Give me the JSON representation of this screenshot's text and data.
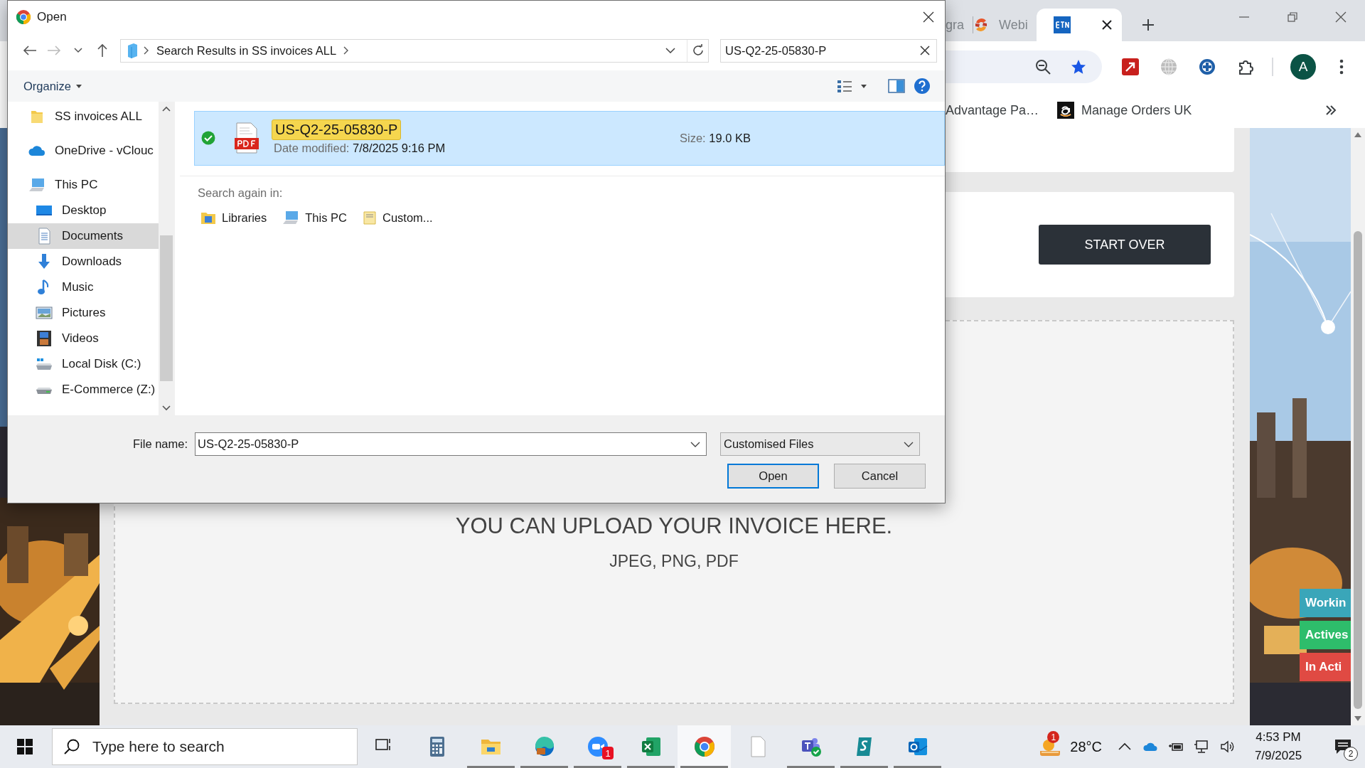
{
  "dialog": {
    "title": "Open",
    "path": "Search Results in SS invoices ALL",
    "search": "US-Q2-25-05830-P",
    "organize": "Organize",
    "nav_pane": [
      {
        "label": "SS invoices ALL",
        "kind": "folder",
        "selected": false
      },
      {
        "label": "OneDrive - vClouc",
        "kind": "onedrive",
        "selected": false
      },
      {
        "label": "This PC",
        "kind": "pc",
        "selected": false,
        "children": [
          {
            "label": "Desktop",
            "kind": "desktop",
            "selected": false
          },
          {
            "label": "Documents",
            "kind": "documents",
            "selected": true
          },
          {
            "label": "Downloads",
            "kind": "downloads",
            "selected": false
          },
          {
            "label": "Music",
            "kind": "music",
            "selected": false
          },
          {
            "label": "Pictures",
            "kind": "pictures",
            "selected": false
          },
          {
            "label": "Videos",
            "kind": "videos",
            "selected": false
          },
          {
            "label": "Local Disk (C:)",
            "kind": "disk",
            "selected": false
          },
          {
            "label": "E-Commerce (Z:)",
            "kind": "network-drive",
            "selected": false
          }
        ]
      }
    ],
    "results": [
      {
        "name": "US-Q2-25-05830-P",
        "date_label": "Date modified:",
        "date": "7/8/2025 9:16 PM",
        "size_label": "Size:",
        "size": "19.0 KB",
        "selected": true,
        "synced": true
      }
    ],
    "search_again": {
      "label": "Search again in:",
      "locations": [
        {
          "label": "Libraries",
          "kind": "libraries"
        },
        {
          "label": "This PC",
          "kind": "pc"
        },
        {
          "label": "Custom...",
          "kind": "custom"
        }
      ]
    },
    "file_name": {
      "label": "File name:",
      "value": "US-Q2-25-05830-P"
    },
    "file_type": "Customised Files",
    "buttons": [
      {
        "label": "Open",
        "default": true
      },
      {
        "label": "Cancel",
        "default": false
      }
    ]
  },
  "browser": {
    "tabs": [
      {
        "title": "gra",
        "selected": false
      },
      {
        "title": "Webi",
        "selected": false
      },
      {
        "selected": true
      }
    ],
    "bookmarks": [
      {
        "label": "Advantage Pa…"
      },
      {
        "label": "Manage Orders UK"
      }
    ],
    "profile_initial": "A",
    "page": {
      "start_over": "START OVER",
      "upload_title": "YOU CAN UPLOAD YOUR INVOICE HERE.",
      "upload_formats": "JPEG, PNG, PDF",
      "side_tabs": [
        {
          "label": "Workin",
          "color": "#3aa6b9"
        },
        {
          "label": "Actives",
          "color": "#2ebd6b"
        },
        {
          "label": "In Acti",
          "color": "#e04a43"
        }
      ]
    }
  },
  "taskbar": {
    "search_placeholder": "Type here to search",
    "apps": [
      {
        "kind": "task-view",
        "running": false,
        "active": false
      },
      {
        "kind": "calculator",
        "running": false,
        "active": false
      },
      {
        "kind": "explorer",
        "running": true,
        "active": false
      },
      {
        "kind": "edge",
        "running": true,
        "active": false
      },
      {
        "kind": "zoom",
        "running": true,
        "active": false,
        "badge": "1"
      },
      {
        "kind": "excel",
        "running": true,
        "active": false
      },
      {
        "kind": "chrome",
        "running": true,
        "active": true
      },
      {
        "kind": "file",
        "running": false,
        "active": false
      },
      {
        "kind": "teams",
        "running": true,
        "active": false
      },
      {
        "kind": "surfshark",
        "running": true,
        "active": false
      },
      {
        "kind": "outlook",
        "running": true,
        "active": false
      }
    ],
    "weather": {
      "temperature": "28°C",
      "badge": "1"
    },
    "time": "4:53 PM",
    "date": "7/9/2025",
    "notifications": "2"
  }
}
